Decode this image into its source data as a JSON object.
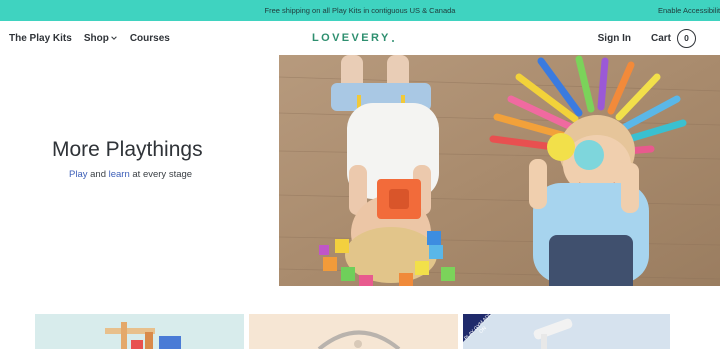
{
  "announcement": {
    "text": "Free shipping on all Play Kits in contiguous US & Canada",
    "accessibility": "Enable Accessibility"
  },
  "header": {
    "nav": [
      "The Play Kits",
      "Shop",
      "Courses"
    ],
    "logo": "LOVEVERY",
    "signin": "Sign In",
    "cart_label": "Cart",
    "cart_count": "0"
  },
  "hero": {
    "title": "More Playthings",
    "sub_play": "Play",
    "sub_and": " and ",
    "sub_learn": "learn",
    "sub_rest": " at every stage"
  },
  "cards": {
    "badge_text": "PLAY GYM ADD-ON"
  },
  "colors": {
    "accent": "#3fd3c0",
    "brand_green": "#2e8f6f",
    "link_blue": "#3d5fb8",
    "badge_navy": "#1f2a6b"
  }
}
